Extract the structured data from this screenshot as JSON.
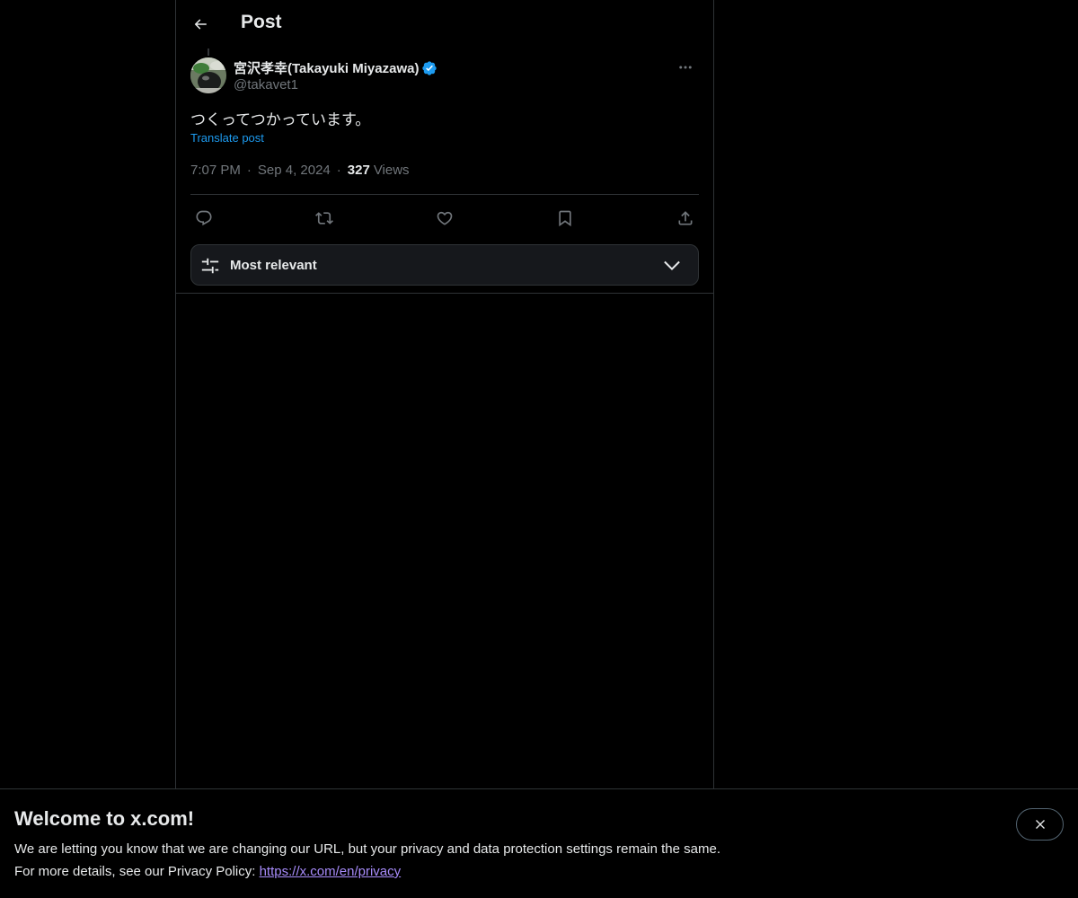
{
  "header": {
    "title": "Post",
    "back_icon": "arrow-left-icon"
  },
  "post": {
    "author": {
      "name": "宮沢孝幸(Takayuki Miyazawa)",
      "handle": "@takavet1",
      "verified": true
    },
    "text": "つくってつかっています。",
    "translate_label": "Translate post",
    "time": "7:07 PM",
    "date": "Sep 4, 2024",
    "views_count": "327",
    "views_label": "Views",
    "separator": "·",
    "actions": [
      "reply-icon",
      "repost-icon",
      "like-icon",
      "bookmark-icon",
      "share-icon"
    ]
  },
  "replies_sort": {
    "label": "Most relevant"
  },
  "banner": {
    "title": "Welcome to x.com!",
    "line1": "We are letting you know that we are changing our URL, but your privacy and data protection settings remain the same.",
    "line2_prefix": "For more details, see our Privacy Policy: ",
    "privacy_link": "https://x.com/en/privacy"
  },
  "colors": {
    "background": "#000000",
    "text": "#e7e9ea",
    "muted": "#71767b",
    "accent": "#1d9bf0",
    "border": "#2f3336",
    "link_visited": "#a78bfa"
  }
}
